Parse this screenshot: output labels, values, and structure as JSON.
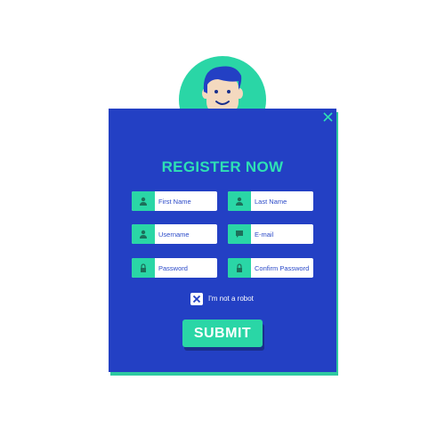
{
  "form": {
    "title": "REGISTER NOW",
    "fields": {
      "first_name": {
        "placeholder": "First Name",
        "icon": "user-icon"
      },
      "last_name": {
        "placeholder": "Last Name",
        "icon": "user-icon"
      },
      "username": {
        "placeholder": "Username",
        "icon": "user-icon"
      },
      "email": {
        "placeholder": "E-mail",
        "icon": "message-icon"
      },
      "password": {
        "placeholder": "Password",
        "icon": "lock-icon"
      },
      "confirm_password": {
        "placeholder": "Confirm Password",
        "icon": "lock-icon"
      }
    },
    "captcha_label": "I'm not a robot",
    "captcha_checked": true,
    "submit_label": "SUBMIT"
  },
  "colors": {
    "card": "#2340c4",
    "accent": "#2ad6a6",
    "title": "#2ee0b4",
    "field_bg": "#ffffff"
  }
}
